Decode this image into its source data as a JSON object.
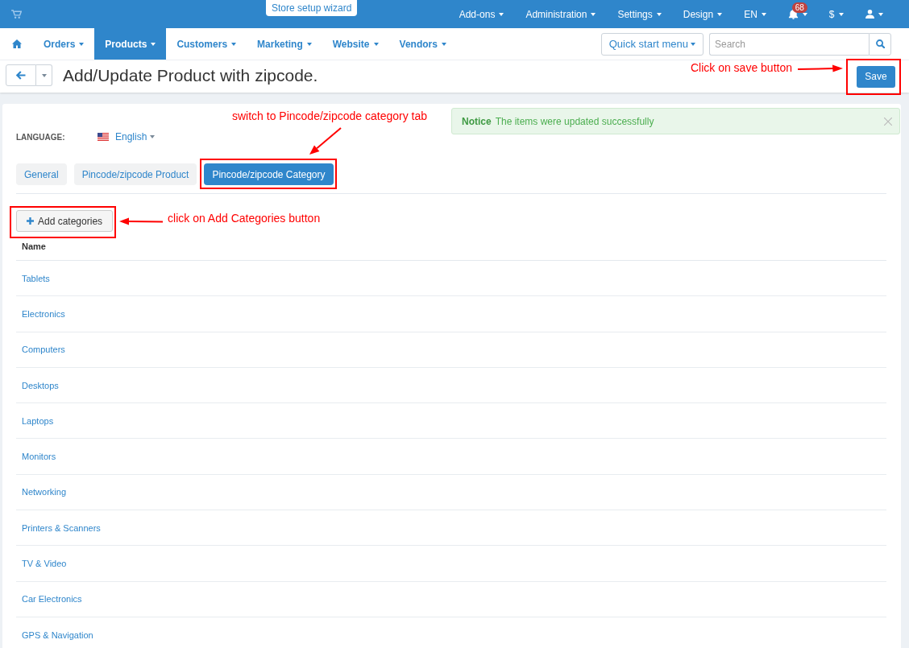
{
  "top_bar": {
    "wizard_button": "Store setup wizard",
    "menu": [
      {
        "label": "Add-ons"
      },
      {
        "label": "Administration"
      },
      {
        "label": "Settings"
      },
      {
        "label": "Design"
      },
      {
        "label": "EN"
      }
    ],
    "notifications": {
      "badge": "68"
    },
    "currency": "$"
  },
  "main_nav": {
    "items": [
      {
        "label": "Orders",
        "selected": false
      },
      {
        "label": "Products",
        "selected": true
      },
      {
        "label": "Customers",
        "selected": false
      },
      {
        "label": "Marketing",
        "selected": false
      },
      {
        "label": "Website",
        "selected": false
      },
      {
        "label": "Vendors",
        "selected": false
      }
    ],
    "quick_start": "Quick start menu",
    "search": {
      "placeholder": "Search"
    }
  },
  "page_header": {
    "title": "Add/Update Product with zipcode.",
    "callout": "Click on save button",
    "save_button": {
      "label": "Save",
      "highlighted": true
    }
  },
  "notice": {
    "title": "Notice",
    "message": "The items were updated successfully"
  },
  "language": {
    "label": "LANGUAGE:",
    "value": "English"
  },
  "tabs_callout": "switch to Pincode/zipcode category tab",
  "tabs": [
    {
      "label": "General",
      "selected": false,
      "highlighted": false
    },
    {
      "label": "Pincode/zipcode Product",
      "selected": false,
      "highlighted": false
    },
    {
      "label": "Pincode/zipcode Category",
      "selected": true,
      "highlighted": true
    }
  ],
  "add_button": {
    "label": "Add categories",
    "highlighted": true,
    "callout": "click on Add Categories button"
  },
  "table": {
    "columns": [
      "Name"
    ],
    "rows": [
      {
        "name": "Tablets"
      },
      {
        "name": "Electronics"
      },
      {
        "name": "Computers"
      },
      {
        "name": "Desktops"
      },
      {
        "name": "Laptops"
      },
      {
        "name": "Monitors"
      },
      {
        "name": "Networking"
      },
      {
        "name": "Printers & Scanners"
      },
      {
        "name": "TV & Video"
      },
      {
        "name": "Car Electronics"
      },
      {
        "name": "GPS & Navigation"
      }
    ]
  }
}
